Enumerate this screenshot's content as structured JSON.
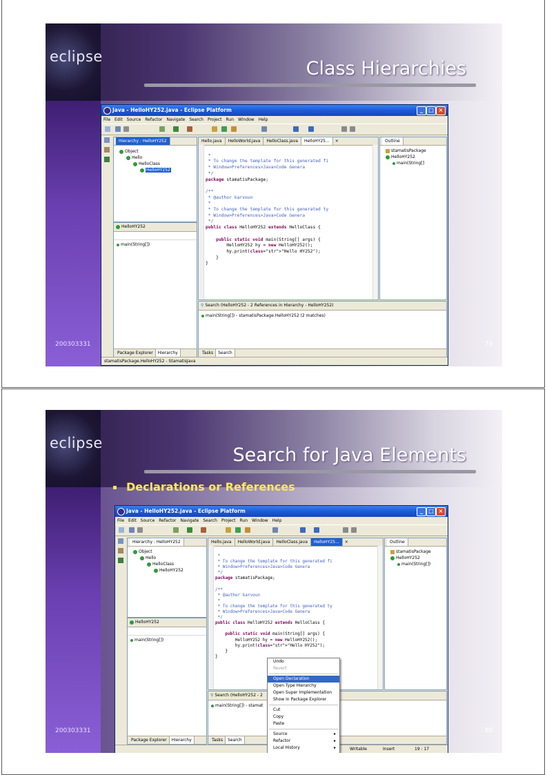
{
  "slides": [
    {
      "logo": "eclipse",
      "title": "Class Hierarchies",
      "footer_left": "200303331",
      "footer_right": "79",
      "window": {
        "title": "Java - HelloHY252.java - Eclipse Platform",
        "menu": [
          "File",
          "Edit",
          "Source",
          "Refactor",
          "Navigate",
          "Search",
          "Project",
          "Run",
          "Window",
          "Help"
        ],
        "hierarchy_tab": "Hierarchy : HelloHY252",
        "tree": [
          "Object",
          "Hello",
          "HelloClass",
          "HelloHY252"
        ],
        "member_header": "HelloHY252",
        "member": "main(String[])",
        "editor_tabs": [
          "Hello.java",
          "HelloWorld.java",
          "HelloClass.java",
          "HelloHY25..."
        ],
        "code_lines": [
          " *",
          " * To change the template for this generated fi",
          " * Window&gt;Preferences&gt;Java&gt;Code Genera",
          " */",
          "package stamatisPackage;",
          "",
          "/**",
          " * @author karvoun",
          " *",
          " * To change the template for this generated ty",
          " * Window&gt;Preferences&gt;Java&gt;Code Genera",
          " */",
          "public class HelloHY252 extends HelloClass {",
          "",
          "    public static void main(String[] args) {",
          "        HelloHY252 hy = new HelloHY252();",
          "        hy.print(\"Hello HY252\");",
          "    }",
          "}"
        ],
        "outline_tab": "Outline",
        "outline_items": [
          "stamatisPackage",
          "HelloHY252",
          "main(String[]"
        ],
        "search_header": "Search (HelloHY252 - 2 References in Hierarchy - HelloHY252)",
        "search_result": "main(String[]) - stamatisPackage.HelloHY252 (2 matches)",
        "left_bottom_tabs": [
          "Package Explorer",
          "Hierarchy"
        ],
        "center_bottom_tabs": [
          "Tasks",
          "Search"
        ],
        "status": "stamatisPackage.HelloHY252 - StamatisJava"
      }
    },
    {
      "logo": "eclipse",
      "title": "Search for Java Elements",
      "bullet": "Declarations or References",
      "footer_left": "200303331",
      "footer_right": "80",
      "window": {
        "title": "Java - HelloHY252.java - Eclipse Platform",
        "menu": [
          "File",
          "Edit",
          "Source",
          "Refactor",
          "Navigate",
          "Search",
          "Project",
          "Run",
          "Window",
          "Help"
        ],
        "hierarchy_tab": "Hierarchy : HelloHY252",
        "tree": [
          "Object",
          "Hello",
          "HelloClass",
          "HelloHY252"
        ],
        "member_header": "HelloHY252",
        "member": "main(String[])",
        "editor_tabs": [
          "Hello.java",
          "HelloWorld.java",
          "HelloClass.java",
          "HelloHY25..."
        ],
        "code_lines": [
          " *",
          " * To change the template for this generated fi",
          " * Window&gt;Preferences&gt;Java&gt;Code Genera",
          " */",
          "package stamatisPackage;",
          "",
          "/**",
          " * @author karvoun",
          " *",
          " * To change the template for this generated ty",
          " * Window&gt;Preferences&gt;Java&gt;Code Genera",
          " */",
          "public class HelloHY252 extends HelloClass {",
          "",
          "    public static void main(String[] args) {",
          "        HelloHY252 hy = new HelloHY252();",
          "        hy.print(\"Hello HY252\");",
          "    }",
          "}"
        ],
        "outline_tab": "Outline",
        "outline_items": [
          "stamatisPackage",
          "HelloHY252",
          "main(String[])"
        ],
        "search_header": "Search (HelloHY252 - 2",
        "search_result": "main(String[]) - stamat",
        "left_bottom_tabs": [
          "Package Explorer",
          "Hierarchy"
        ],
        "center_bottom_tabs": [
          "Tasks",
          "Search"
        ],
        "status_cells": [
          "Writable",
          "Insert",
          "19 : 17"
        ],
        "context_menu": {
          "items": [
            "Undo",
            "Revert",
            "Open Declaration",
            "Open Type Hierarchy",
            "Open Super Implementation",
            "Show in Package Explorer",
            "Cut",
            "Copy",
            "Paste",
            "Source",
            "Refactor",
            "Local History"
          ],
          "selected": "Open Declaration",
          "disabled": "Revert"
        }
      }
    }
  ]
}
